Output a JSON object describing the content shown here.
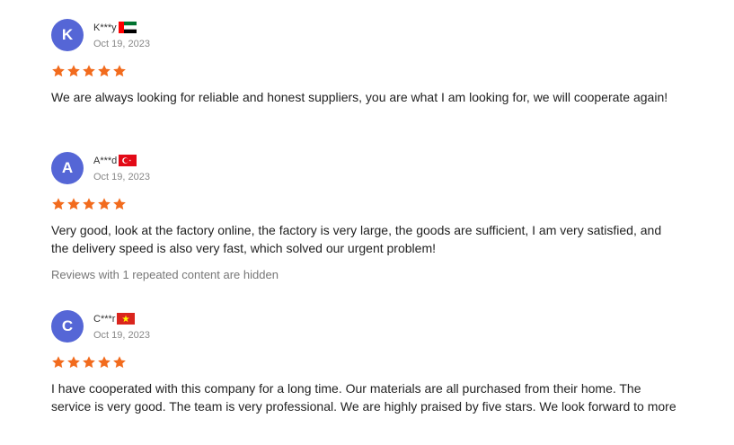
{
  "colors": {
    "avatar_bg": "#5566d6",
    "star": "#f26b1d",
    "text": "#222222",
    "muted": "#888888"
  },
  "reviews": [
    {
      "initial": "K",
      "name": "K***y",
      "flag": "flag-uae-icon",
      "date": "Oct 19, 2023",
      "rating": 5,
      "text": "We are always looking for reliable and honest suppliers, you are what I am looking for, we will cooperate again!"
    },
    {
      "initial": "A",
      "name": "A***d",
      "flag": "flag-turkey-icon",
      "date": "Oct 19, 2023",
      "rating": 5,
      "text": "Very good, look at the factory online, the factory is very large, the goods are sufficient, I am very satisfied, and the delivery speed is also very fast, which solved our urgent problem!"
    },
    {
      "initial": "C",
      "name": "C***r",
      "flag": "flag-vietnam-icon",
      "date": "Oct 19, 2023",
      "rating": 5,
      "text": "I have cooperated with this company for a long time. Our materials are all purchased from their home. The service is very good. The team is very professional. We are highly praised by five stars. We look forward to more"
    }
  ],
  "hidden_note": "Reviews with 1 repeated content are hidden"
}
